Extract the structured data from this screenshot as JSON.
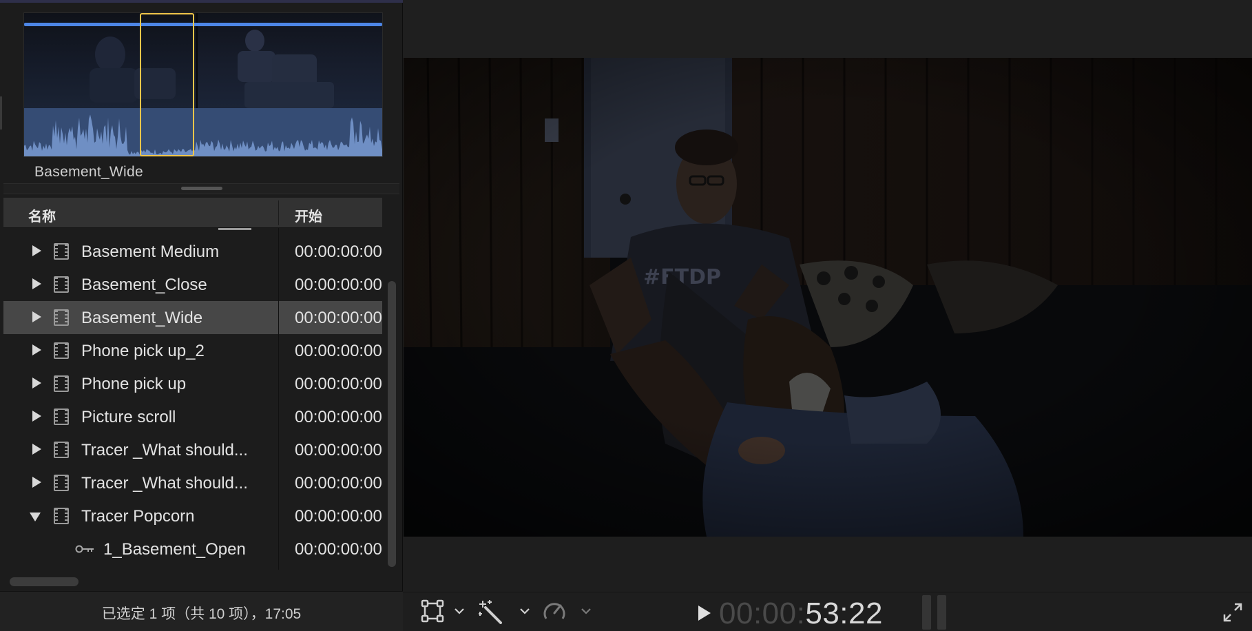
{
  "browser": {
    "filmstrip": {
      "clip_name": "Basement_Wide"
    },
    "list": {
      "columns": {
        "name": "名称",
        "start": "开始"
      },
      "rows": [
        {
          "name": "Basement Medium",
          "start": "00:00:00:00",
          "type": "clip",
          "expanded": false,
          "selected": false
        },
        {
          "name": "Basement_Close",
          "start": "00:00:00:00",
          "type": "clip",
          "expanded": false,
          "selected": false
        },
        {
          "name": "Basement_Wide",
          "start": "00:00:00:00",
          "type": "clip",
          "expanded": false,
          "selected": true
        },
        {
          "name": "Phone pick up_2",
          "start": "00:00:00:00",
          "type": "clip",
          "expanded": false,
          "selected": false
        },
        {
          "name": "Phone pick up",
          "start": "00:00:00:00",
          "type": "clip",
          "expanded": false,
          "selected": false
        },
        {
          "name": "Picture scroll",
          "start": "00:00:00:00",
          "type": "clip",
          "expanded": false,
          "selected": false
        },
        {
          "name": "Tracer _What should...",
          "start": "00:00:00:00",
          "type": "clip",
          "expanded": false,
          "selected": false
        },
        {
          "name": "Tracer _What should...",
          "start": "00:00:00:00",
          "type": "clip",
          "expanded": false,
          "selected": false
        },
        {
          "name": "Tracer Popcorn",
          "start": "00:00:00:00",
          "type": "clip",
          "expanded": true,
          "selected": false
        },
        {
          "name": "1_Basement_Open",
          "start": "00:00:00:00",
          "type": "keyword",
          "expanded": false,
          "selected": false
        }
      ]
    },
    "status": "已选定 1 项（共 10 项），17:05"
  },
  "viewer": {
    "timecode_dim": "00:00:",
    "timecode_bright": "53:22",
    "icons": {
      "transform": "transform-crop-icon",
      "enhance": "magic-wand-icon",
      "retime": "speedometer-icon",
      "play": "play-icon",
      "fullscreen": "fullscreen-icon"
    }
  },
  "colors": {
    "filmstrip_bar": "#4d86e6",
    "playhead_range": "#f0c54a",
    "selected_row": "#474747",
    "waveform": "#4a6595"
  }
}
